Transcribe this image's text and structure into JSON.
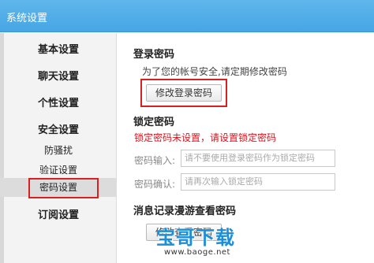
{
  "window": {
    "title": "系统设置"
  },
  "sidebar": {
    "items": [
      {
        "label": "基本设置"
      },
      {
        "label": "聊天设置"
      },
      {
        "label": "个性设置"
      },
      {
        "label": "安全设置"
      },
      {
        "label": "防骚扰"
      },
      {
        "label": "验证设置"
      },
      {
        "label": "密码设置"
      },
      {
        "label": "订阅设置"
      }
    ]
  },
  "login_password": {
    "title": "登录密码",
    "description": "为了您的帐号安全,请定期修改密码",
    "button_label": "修改登录密码"
  },
  "lock_password": {
    "title": "锁定密码",
    "warning": "锁定密码未设置，请设置锁定密码",
    "input_label": "密码输入:",
    "input_placeholder": "请不要使用登录密码作为锁定密码",
    "confirm_label": "密码确认:",
    "confirm_placeholder": "请再次输入锁定密码"
  },
  "roaming_password": {
    "title": "消息记录漫游查看密码",
    "button_label": "修改查看密码"
  },
  "watermark": {
    "text": "宝哥下载",
    "url": "www.baoge.net"
  },
  "colors": {
    "titlebar": "#4aa8e6",
    "highlight_border": "#d92020",
    "warning_text": "#d9141e"
  }
}
